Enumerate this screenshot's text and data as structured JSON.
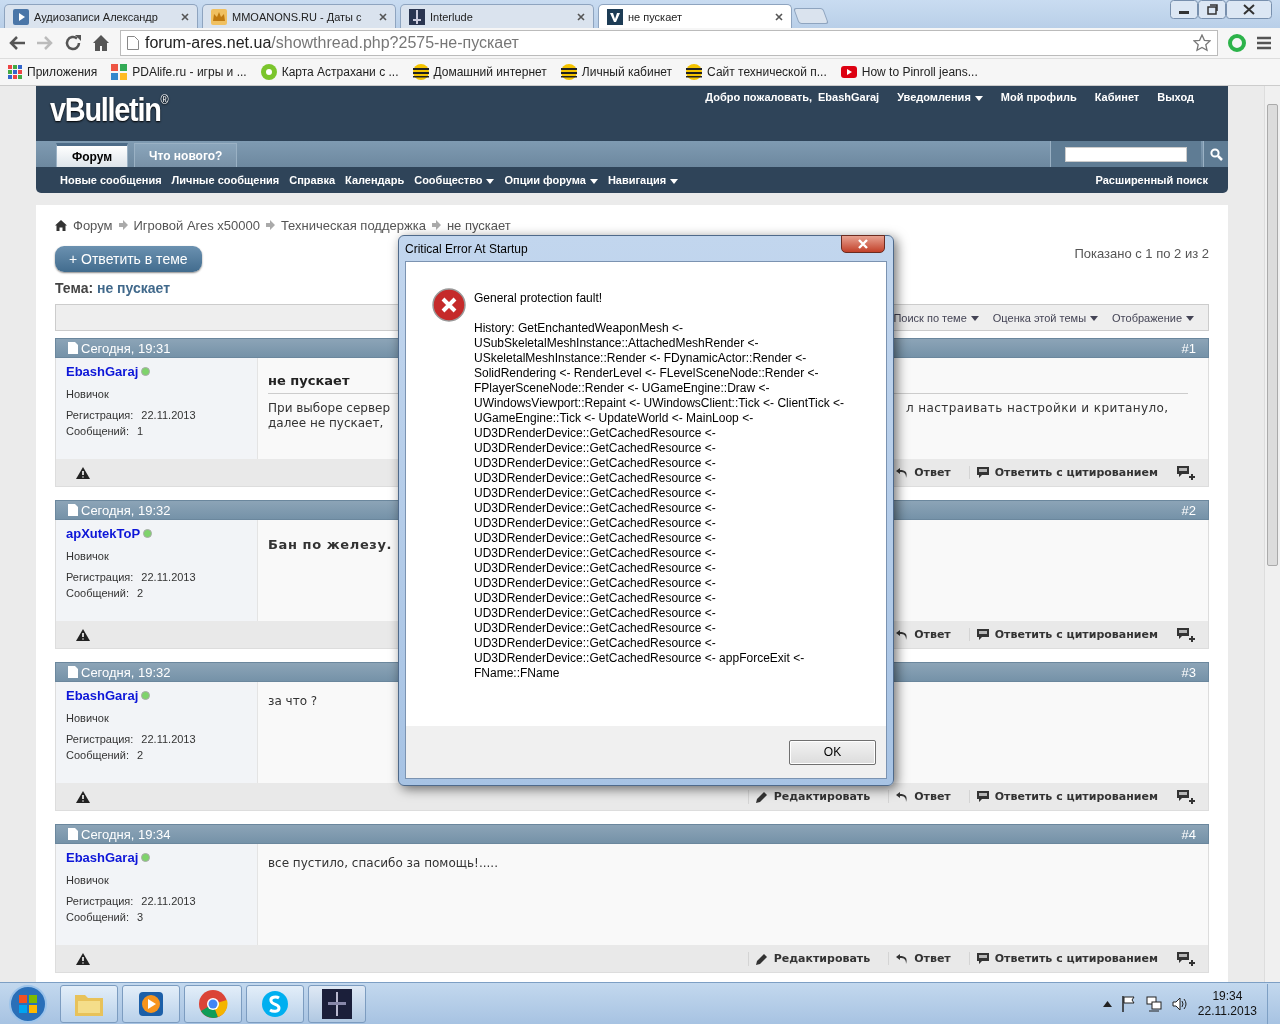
{
  "browser": {
    "tabs": [
      {
        "title": "Аудиозаписи Александр",
        "selected": false
      },
      {
        "title": "MMOANONS.RU - Даты с",
        "selected": false
      },
      {
        "title": "Interlude",
        "selected": false
      },
      {
        "title": "не пускает",
        "selected": true
      }
    ],
    "url_host": "forum-ares.net.ua",
    "url_path": "/showthread.php?2575-не-пускает",
    "bookmarks": [
      {
        "kind": "apps",
        "label": "Приложения"
      },
      {
        "kind": "tiles",
        "label": "PDAlife.ru - игры и ..."
      },
      {
        "kind": "map",
        "label": "Карта Астрахани с ..."
      },
      {
        "kind": "beeline",
        "label": "Домашний интернет"
      },
      {
        "kind": "beeline",
        "label": "Личный кабинет"
      },
      {
        "kind": "beeline",
        "label": "Сайт технической п..."
      },
      {
        "kind": "video",
        "label": "How to Pinroll jeans..."
      }
    ]
  },
  "forum_header": {
    "logo": "vBulletin$^{®}$",
    "welcome": "Добро пожаловать,",
    "username": "EbashGaraj",
    "user_links": [
      {
        "label": "Уведомления",
        "dropdown": true
      },
      {
        "label": "Мой профиль",
        "dropdown": false
      },
      {
        "label": "Кабинет",
        "dropdown": false
      },
      {
        "label": "Выход",
        "dropdown": false
      }
    ],
    "tabs": [
      {
        "label": "Форум",
        "selected": true
      },
      {
        "label": "Что нового?",
        "selected": false
      }
    ],
    "subnav": [
      {
        "label": "Новые сообщения",
        "dropdown": false
      },
      {
        "label": "Личные сообщения",
        "dropdown": false
      },
      {
        "label": "Справка",
        "dropdown": false
      },
      {
        "label": "Календарь",
        "dropdown": false
      },
      {
        "label": "Сообщество",
        "dropdown": true
      },
      {
        "label": "Опции форума",
        "dropdown": true
      },
      {
        "label": "Навигация",
        "dropdown": true
      }
    ],
    "advanced_search": "Расширенный поиск"
  },
  "breadcrumb": [
    "Форум",
    "Игровой Ares x50000",
    "Техническая поддержка",
    "не пускает"
  ],
  "reply_button": "+ Ответить в теме",
  "thread": {
    "label": "Тема:",
    "title": "не пускает"
  },
  "pagination_info": "Показано с 1 по 2 из 2",
  "tools": [
    {
      "label": "Поиск по теме",
      "dropdown": true
    },
    {
      "label": "Оценка этой темы",
      "dropdown": true
    },
    {
      "label": "Отображение",
      "dropdown": true
    }
  ],
  "posts": [
    {
      "date": "Сегодня, 19:31",
      "number": "#1",
      "user": "EbashGaraj",
      "online": true,
      "rank": "Новичок",
      "reg_label": "Регистрация:",
      "reg": "22.11.2013",
      "count_label": "Сообщений:",
      "count": "1",
      "title": "не пускает",
      "body_left": "При выборе сервер\nдалее не пускает,",
      "body_right": "л настраивать настройки и критануло,",
      "actions": [
        {
          "kind": "reply",
          "label": "Ответ"
        },
        {
          "kind": "quote",
          "label": "Ответить с цитированием"
        }
      ]
    },
    {
      "date": "Сегодня, 19:32",
      "number": "#2",
      "user": "apXutekToP",
      "online": true,
      "rank": "Новичок",
      "reg_label": "Регистрация:",
      "reg": "22.11.2013",
      "count_label": "Сообщений:",
      "count": "2",
      "body_bold": "Бан по железу.",
      "actions": [
        {
          "kind": "reply",
          "label": "Ответ"
        },
        {
          "kind": "quote",
          "label": "Ответить с цитированием"
        }
      ]
    },
    {
      "date": "Сегодня, 19:32",
      "number": "#3",
      "user": "EbashGaraj",
      "online": true,
      "rank": "Новичок",
      "reg_label": "Регистрация:",
      "reg": "22.11.2013",
      "count_label": "Сообщений:",
      "count": "2",
      "body_left": "за что ?",
      "actions": [
        {
          "kind": "edit",
          "label": "Редактировать"
        },
        {
          "kind": "reply",
          "label": "Ответ"
        },
        {
          "kind": "quote",
          "label": "Ответить с цитированием"
        }
      ]
    },
    {
      "date": "Сегодня, 19:34",
      "number": "#4",
      "user": "EbashGaraj",
      "online": true,
      "rank": "Новичок",
      "reg_label": "Регистрация:",
      "reg": "22.11.2013",
      "count_label": "Сообщений:",
      "count": "3",
      "body_left": "все пустило, спасибо за помощь!.....",
      "actions": [
        {
          "kind": "edit",
          "label": "Редактировать"
        },
        {
          "kind": "reply",
          "label": "Ответ"
        },
        {
          "kind": "quote",
          "label": "Ответить с цитированием"
        }
      ]
    }
  ],
  "dialog": {
    "title": "Critical Error At Startup",
    "message": "General protection fault!",
    "history_lines": [
      "History: GetEnchantedWeaponMesh <-",
      "USubSkeletalMeshInstance::AttachedMeshRender <-",
      "USkeletalMeshInstance::Render <- FDynamicActor::Render <-",
      "SolidRendering <- RenderLevel <- FLevelSceneNode::Render <-",
      "FPlayerSceneNode::Render <- UGameEngine::Draw <-",
      "UWindowsViewport::Repaint <- UWindowsClient::Tick <- ClientTick <-",
      "UGameEngine::Tick <- UpdateWorld <- MainLoop <-",
      "UD3DRenderDevice::GetCachedResource <-",
      "UD3DRenderDevice::GetCachedResource <-",
      "UD3DRenderDevice::GetCachedResource <-",
      "UD3DRenderDevice::GetCachedResource <-",
      "UD3DRenderDevice::GetCachedResource <-",
      "UD3DRenderDevice::GetCachedResource <-",
      "UD3DRenderDevice::GetCachedResource <-",
      "UD3DRenderDevice::GetCachedResource <-",
      "UD3DRenderDevice::GetCachedResource <-",
      "UD3DRenderDevice::GetCachedResource <-",
      "UD3DRenderDevice::GetCachedResource <-",
      "UD3DRenderDevice::GetCachedResource <-",
      "UD3DRenderDevice::GetCachedResource <-",
      "UD3DRenderDevice::GetCachedResource <-",
      "UD3DRenderDevice::GetCachedResource <-",
      "UD3DRenderDevice::GetCachedResource <- appForceExit <-",
      "FName::FName"
    ],
    "ok_button": "OK"
  },
  "taskbar": {
    "time": "19:34",
    "date": "22.11.2013"
  }
}
